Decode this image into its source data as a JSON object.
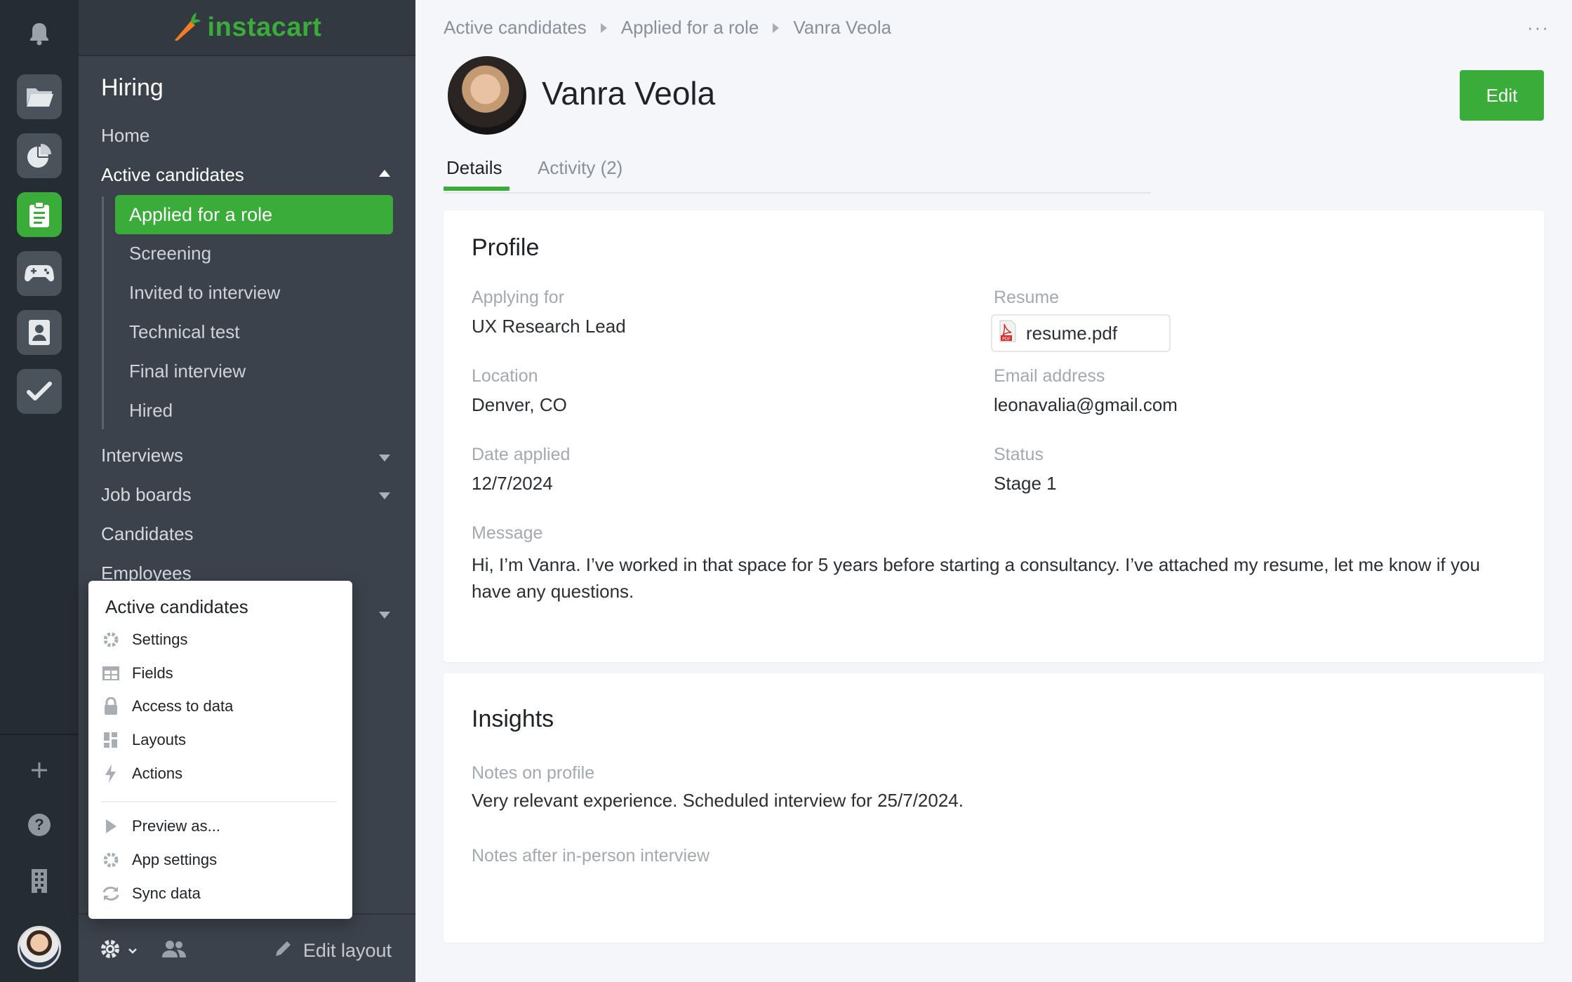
{
  "brand": {
    "name": "instacart",
    "accent": "#3aac3a"
  },
  "rail": {
    "icons": [
      "bell-icon",
      "folder-icon",
      "pie-chart-icon",
      "clipboard-icon",
      "gamepad-icon",
      "contact-card-icon",
      "check-icon",
      "plus-icon",
      "help-icon",
      "building-icon"
    ]
  },
  "nav": {
    "title": "Hiring",
    "home": "Home",
    "active_candidates": "Active candidates",
    "sub_items": [
      "Applied for a role",
      "Screening",
      "Invited to interview",
      "Technical test",
      "Final interview",
      "Hired"
    ],
    "interviews": "Interviews",
    "job_boards": "Job boards",
    "candidates": "Candidates",
    "employees": "Employees",
    "edit_layout": "Edit layout"
  },
  "popup": {
    "title": "Active candidates",
    "items": [
      "Settings",
      "Fields",
      "Access to data",
      "Layouts",
      "Actions",
      "Preview as...",
      "App settings",
      "Sync data"
    ]
  },
  "breadcrumb": [
    "Active candidates",
    "Applied for a role",
    "Vanra Veola"
  ],
  "more": "···",
  "candidate": {
    "name": "Vanra Veola"
  },
  "edit_button": "Edit",
  "tabs": [
    "Details",
    "Activity (2)"
  ],
  "profile": {
    "title": "Profile",
    "applying_for_label": "Applying for",
    "applying_for": "UX Research Lead",
    "resume_label": "Resume",
    "resume_file": "resume.pdf",
    "location_label": "Location",
    "location": "Denver, CO",
    "email_label": "Email address",
    "email": "leonavalia@gmail.com",
    "date_label": "Date applied",
    "date": "12/7/2024",
    "status_label": "Status",
    "status": "Stage 1",
    "message_label": "Message",
    "message": "Hi, I’m Vanra. I’ve worked in that space for 5 years before starting a consultancy. I’ve attached my resume, let me know if you have any questions."
  },
  "insights": {
    "title": "Insights",
    "notes_label": "Notes on profile",
    "notes": "Very relevant experience. Scheduled interview for 25/7/2024.",
    "after_label": "Notes after in-person interview"
  }
}
